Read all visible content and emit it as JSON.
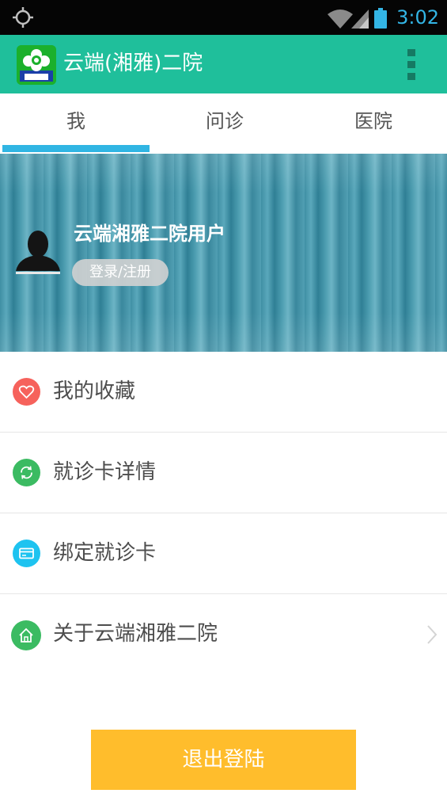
{
  "status_bar": {
    "time": "3:02"
  },
  "app_bar": {
    "title": "云端(湘雅)二院"
  },
  "tabs": [
    {
      "label": "我",
      "active": true
    },
    {
      "label": "问诊",
      "active": false
    },
    {
      "label": "医院",
      "active": false
    }
  ],
  "profile": {
    "name": "云端湘雅二院用户",
    "login_label": "登录/注册"
  },
  "menu": {
    "items": [
      {
        "label": "我的收藏",
        "icon": "heart-icon",
        "color": "#f6625c"
      },
      {
        "label": "就诊卡详情",
        "icon": "refresh-icon",
        "color": "#3bbb62"
      },
      {
        "label": "绑定就诊卡",
        "icon": "card-icon",
        "color": "#1ec3f0"
      },
      {
        "label": "关于云端湘雅二院",
        "icon": "home-icon",
        "color": "#3bbb62"
      }
    ]
  },
  "logout": {
    "label": "退出登陆"
  },
  "colors": {
    "accent": "#1fbf9b",
    "tab_indicator": "#30b5e3",
    "logout": "#ffbd2c"
  }
}
